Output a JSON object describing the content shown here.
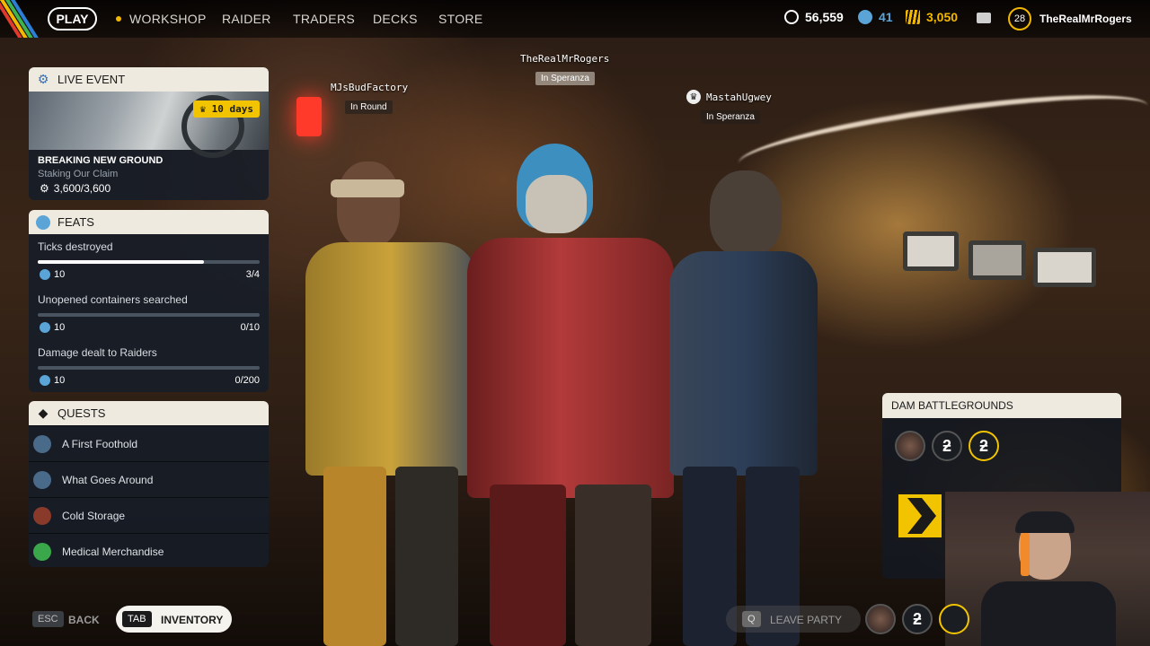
{
  "topbar": {
    "play": "PLAY",
    "nav": [
      "WORKSHOP",
      "RAIDER",
      "TRADERS",
      "DECKS",
      "STORE"
    ],
    "currency": {
      "credits": "56,559",
      "tokens": "41",
      "raider_coins": "3,050"
    },
    "level": "28",
    "username": "TheRealMrRogers",
    "stripe_colors": [
      "#e03a2f",
      "#f2b800",
      "#3fb34f",
      "#2d7fd6"
    ]
  },
  "live_event": {
    "header": "LIVE EVENT",
    "badge": "10 days",
    "title": "BREAKING NEW GROUND",
    "subtitle": "Staking Our Claim",
    "progress": "3,600/3,600"
  },
  "feats": {
    "header": "FEATS",
    "items": [
      {
        "name": "Ticks destroyed",
        "reward": "10",
        "count": "3/4",
        "progress": 0.75
      },
      {
        "name": "Unopened containers searched",
        "reward": "10",
        "count": "0/10",
        "progress": 0
      },
      {
        "name": "Damage dealt to Raiders",
        "reward": "10",
        "count": "0/200",
        "progress": 0
      }
    ]
  },
  "quests": {
    "header": "QUESTS",
    "items": [
      {
        "name": "A First Foothold",
        "icon_color": "#4a6a8a"
      },
      {
        "name": "What Goes Around",
        "icon_color": "#4a6a8a"
      },
      {
        "name": "Cold Storage",
        "icon_color": "#8a3a2a"
      },
      {
        "name": "Medical Merchandise",
        "icon_color": "#3aa84a"
      }
    ]
  },
  "party": {
    "players": [
      {
        "name": "MJsBudFactory",
        "status": "In Round"
      },
      {
        "name": "TheRealMrRogers",
        "status": "In Speranza"
      },
      {
        "name": "MastahUgwey",
        "status": "In Speranza"
      }
    ]
  },
  "map_card": {
    "title": "DAM BATTLEGROUNDS"
  },
  "bottom": {
    "esc_key": "ESC",
    "back": "BACK",
    "tab_key": "TAB",
    "inventory": "INVENTORY",
    "q_key": "Q",
    "leave_party": "LEAVE PARTY"
  },
  "colors": {
    "accent_yellow": "#f2c400",
    "panel_header": "#eeeae0",
    "panel_bg": "#161c28"
  }
}
